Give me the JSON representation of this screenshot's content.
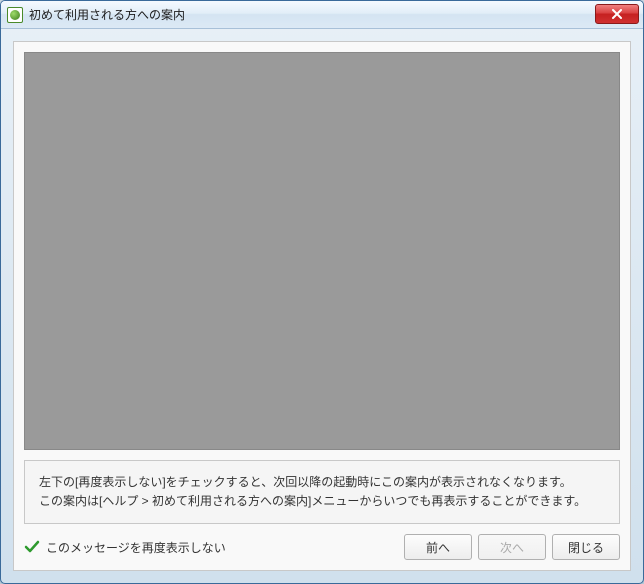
{
  "titlebar": {
    "title": "初めて利用される方への案内"
  },
  "info": {
    "line1": "左下の[再度表示しない]をチェックすると、次回以降の起動時にこの案内が表示されなくなります。",
    "line2": "この案内は[ヘルプ > 初めて利用される方への案内]メニューからいつでも再表示することができます。"
  },
  "footer": {
    "checkbox_label": "このメッセージを再度表示しない",
    "checkbox_checked": true,
    "buttons": {
      "prev": "前へ",
      "next": "次へ",
      "close": "閉じる"
    }
  }
}
